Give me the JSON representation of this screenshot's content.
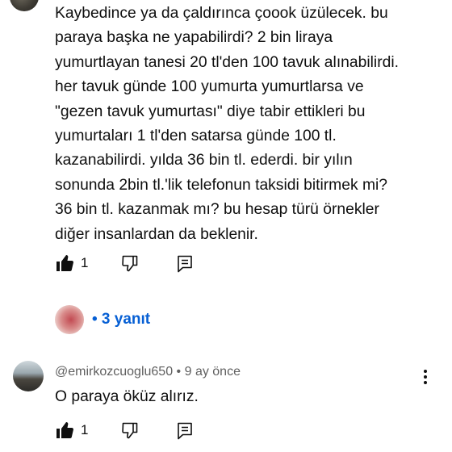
{
  "comment1": {
    "text": "Kaybedince ya da çaldırınca çoook üzülecek. bu\nparaya başka ne yapabilirdi? 2 bin liraya\nyumurtlayan tanesi 20 tl'den 100 tavuk alınabilirdi.\nher tavuk günde 100 yumurta yumurtlarsa ve\n\"gezen tavuk yumurtası\" diye tabir ettikleri bu\nyumurtaları 1 tl'den satarsa günde 100 tl.\nkazanabilirdi. yılda 36 bin tl. ederdi. bir yılın\nsonunda 2bin tl.'lik telefonun taksidi bitirmek mi?\n36 bin tl. kazanmak mı? bu hesap türü örnekler\ndiğer insanlardan da beklenir.",
    "like_count": "1",
    "replies_label": "• 3 yanıt"
  },
  "comment2": {
    "author": "@emirkozcuoglu650",
    "time": "9 ay önce",
    "separator": " • ",
    "text": "O paraya öküz alırız.",
    "like_count": "1"
  },
  "icons": {
    "like": "thumbs-up-icon",
    "dislike": "thumbs-down-icon",
    "reply": "reply-comment-icon",
    "more": "more-vertical-icon"
  },
  "colors": {
    "text": "#0f0f0f",
    "secondary": "#606060",
    "link": "#065fd4"
  }
}
